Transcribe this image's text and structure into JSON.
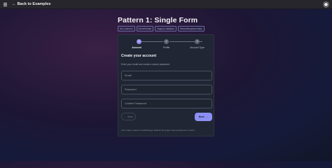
{
  "topbar": {
    "back_label": "Back to Examples",
    "back_icon": "arrow-left-icon",
    "menu_icon": "hamburger-menu-icon",
    "github_icon": "github-icon"
  },
  "page": {
    "title": "Pattern 1: Single Form",
    "tags": [
      "Use useForm",
      "FormProvider",
      "trigger() validation",
      "WizardIntegrated State"
    ]
  },
  "stepper": {
    "steps": [
      {
        "number": "1",
        "label": "Account",
        "active": true
      },
      {
        "number": "2",
        "label": "Profile",
        "active": false
      },
      {
        "number": "3",
        "label": "Account Type",
        "active": false
      }
    ]
  },
  "form": {
    "title": "Create your account",
    "subtitle": "Enter your email and create a secure password",
    "email_placeholder": "Email",
    "password_placeholder": "Password",
    "confirm_placeholder": "Confirm Password",
    "back_label": "Back",
    "next_label": "Next",
    "note": "Form state is saved to localStorage. Refresh the page to see persistence in action."
  },
  "colors": {
    "accent": "#9b8cf8",
    "next_button": "#8c8ff2"
  }
}
